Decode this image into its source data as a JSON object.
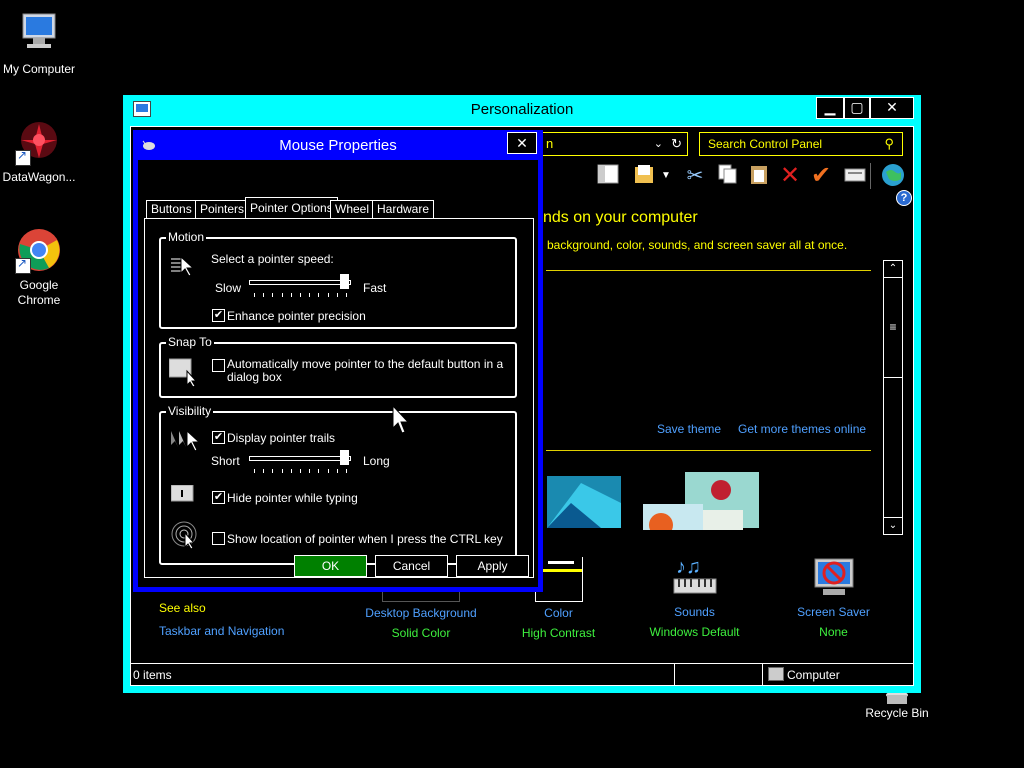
{
  "desktop": {
    "icons": [
      {
        "label": "My Computer",
        "icon": "computer-icon"
      },
      {
        "label": "DataWagon...",
        "icon": "datawagon-icon"
      },
      {
        "label": "Google\nChrome",
        "icon": "chrome-icon"
      },
      {
        "label": "Recycle Bin",
        "icon": "recycle-bin-icon"
      }
    ]
  },
  "personalization": {
    "title": "Personalization",
    "address_text": "n",
    "search_placeholder": "Search Control Panel",
    "heading": "nds on your computer",
    "subheading": "background, color, sounds, and screen saver all at once.",
    "save_theme": "Save theme",
    "get_more_themes": "Get more themes online",
    "see_also": "See also",
    "taskbar_link": "Taskbar and Navigation",
    "bottom_items": [
      {
        "title": "Desktop Background",
        "value": "Solid Color",
        "icon": "desktop-background-icon"
      },
      {
        "title": "Color",
        "value": "High Contrast",
        "icon": "color-icon"
      },
      {
        "title": "Sounds",
        "value": "Windows Default",
        "icon": "sounds-icon"
      },
      {
        "title": "Screen Saver",
        "value": "None",
        "icon": "screen-saver-icon"
      }
    ],
    "status_left": "0 items",
    "status_right": "Computer",
    "colors": {
      "frame": "#00ffff",
      "link": "#4fa0ff",
      "value": "#3ef03e",
      "heading": "#ffff00"
    }
  },
  "mouse": {
    "title": "Mouse Properties",
    "tabs": [
      "Buttons",
      "Pointers",
      "Pointer Options",
      "Wheel",
      "Hardware"
    ],
    "selected_tab": "Pointer Options",
    "motion": {
      "legend": "Motion",
      "speed_label": "Select a pointer speed:",
      "slow": "Slow",
      "fast": "Fast",
      "speed_value": 1.0,
      "precision_label": "Enhance pointer precision",
      "precision_checked": true
    },
    "snap": {
      "legend": "Snap To",
      "label": "Automatically move pointer to the default button in a dialog box",
      "checked": false
    },
    "visibility": {
      "legend": "Visibility",
      "trails_label": "Display pointer trails",
      "trails_checked": true,
      "short": "Short",
      "long": "Long",
      "trails_value": 1.0,
      "hide_label": "Hide pointer while typing",
      "hide_checked": true,
      "ctrl_label": "Show location of pointer when I press the CTRL key",
      "ctrl_checked": false
    },
    "buttons": {
      "ok": "OK",
      "cancel": "Cancel",
      "apply": "Apply"
    },
    "colors": {
      "frame": "#0000ff",
      "ok": "#008000"
    }
  }
}
